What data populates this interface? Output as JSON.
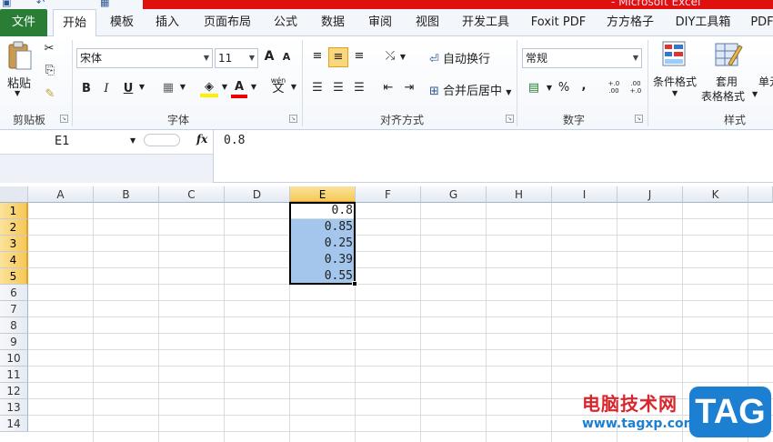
{
  "titlebar": {
    "title": "- Microsoft Excel",
    "colors": {
      "band": "#e0100f"
    }
  },
  "tabs": [
    {
      "label": "文件"
    },
    {
      "label": "开始"
    },
    {
      "label": "模板"
    },
    {
      "label": "插入"
    },
    {
      "label": "页面布局"
    },
    {
      "label": "公式"
    },
    {
      "label": "数据"
    },
    {
      "label": "审阅"
    },
    {
      "label": "视图"
    },
    {
      "label": "开发工具"
    },
    {
      "label": "Foxit PDF"
    },
    {
      "label": "方方格子"
    },
    {
      "label": "DIY工具箱"
    },
    {
      "label": "PDF"
    }
  ],
  "ribbon": {
    "clipboard": {
      "paste": "粘贴",
      "label": "剪贴板"
    },
    "font": {
      "name": "宋体",
      "size": "11",
      "bold": "B",
      "italic": "I",
      "underline": "U",
      "grow": "A",
      "shrink": "A",
      "font_color_glyph": "A",
      "phonetic": "wén",
      "phonetic_char": "文",
      "label": "字体"
    },
    "alignment": {
      "wrap": "自动换行",
      "merge": "合并后居中",
      "label": "对齐方式"
    },
    "number": {
      "format": "常规",
      "percent": "%",
      "comma": ",",
      "inc": "+.0 .00",
      "dec": ".00 +.0",
      "label": "数字"
    },
    "styles": {
      "conditional": "条件格式",
      "table": "套用",
      "table2": "表格格式",
      "cell": "单元",
      "label": "样式"
    }
  },
  "formula_bar": {
    "name_box": "E1",
    "fx": "fx",
    "value": "0.8"
  },
  "grid": {
    "columns": [
      "A",
      "B",
      "C",
      "D",
      "E",
      "F",
      "G",
      "H",
      "I",
      "J",
      "K"
    ],
    "selected_column": "E",
    "rows": [
      "1",
      "2",
      "3",
      "4",
      "5",
      "6",
      "7",
      "8",
      "9",
      "10",
      "11",
      "12",
      "13",
      "14"
    ],
    "selected_rows": [
      "1",
      "2",
      "3",
      "4",
      "5"
    ],
    "cells": {
      "E1": "0.8",
      "E2": "0.85",
      "E3": "0.25",
      "E4": "0.39",
      "E5": "0.55"
    },
    "highlight_color": "#a4c6ec"
  },
  "watermark": {
    "cn": "电脑技术网",
    "url": "www.tagxp.com",
    "tag": "TAG"
  }
}
